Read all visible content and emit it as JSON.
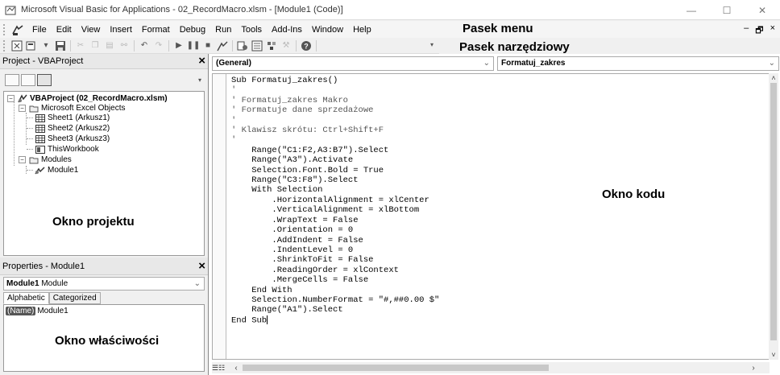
{
  "window": {
    "title": "Microsoft Visual Basic for Applications - 02_RecordMacro.xlsm - [Module1 (Code)]",
    "minimize": "—",
    "maximize": "☐",
    "close": "✕"
  },
  "menu": {
    "items": [
      "File",
      "Edit",
      "View",
      "Insert",
      "Format",
      "Debug",
      "Run",
      "Tools",
      "Add-Ins",
      "Window",
      "Help"
    ],
    "mdi_minimize": "–",
    "mdi_restore": "🗗",
    "mdi_close": "×"
  },
  "annotations": {
    "menu_bar": "Pasek menu",
    "toolbar": "Pasek narzędziowy",
    "project_window": "Okno projektu",
    "code_window": "Okno kodu",
    "properties_window": "Okno właściwości"
  },
  "project": {
    "title": "Project - VBAProject",
    "close": "×",
    "tree": {
      "root": "VBAProject (02_RecordMacro.xlsm)",
      "folder_objects": "Microsoft Excel Objects",
      "sheet1": "Sheet1 (Arkusz1)",
      "sheet2": "Sheet2 (Arkusz2)",
      "sheet3": "Sheet3 (Arkusz3)",
      "workbook": "ThisWorkbook",
      "folder_modules": "Modules",
      "module1": "Module1"
    }
  },
  "properties": {
    "title": "Properties - Module1",
    "close": "×",
    "object_name": "Module1",
    "object_type": "Module",
    "tab_alphabetic": "Alphabetic",
    "tab_categorized": "Categorized",
    "prop_name": "(Name)",
    "prop_value": "Module1"
  },
  "code": {
    "object_combo": "(General)",
    "proc_combo": "Formatuj_zakres",
    "lines": [
      "Sub Formatuj_zakres()",
      "'",
      "' Formatuj_zakres Makro",
      "' Formatuje dane sprzedażowe",
      "'",
      "' Klawisz skrótu: Ctrl+Shift+F",
      "'",
      "    Range(\"C1:F2,A3:B7\").Select",
      "    Range(\"A3\").Activate",
      "    Selection.Font.Bold = True",
      "    Range(\"C3:F8\").Select",
      "    With Selection",
      "        .HorizontalAlignment = xlCenter",
      "        .VerticalAlignment = xlBottom",
      "        .WrapText = False",
      "        .Orientation = 0",
      "        .AddIndent = False",
      "        .IndentLevel = 0",
      "        .ShrinkToFit = False",
      "        .ReadingOrder = xlContext",
      "        .MergeCells = False",
      "    End With",
      "    Selection.NumberFormat = \"#,##0.00 $\"",
      "    Range(\"A1\").Select",
      "End Sub"
    ]
  }
}
